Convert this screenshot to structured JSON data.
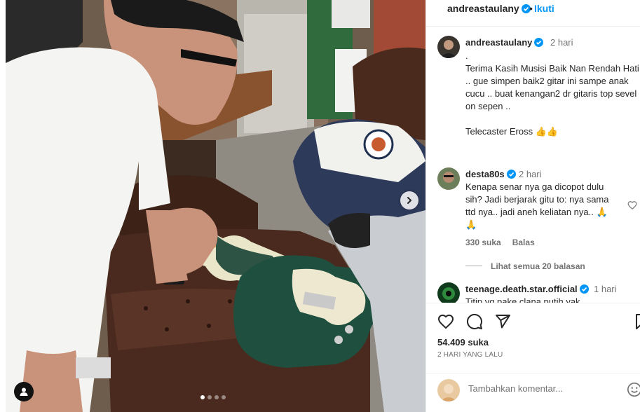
{
  "post": {
    "author": "andreastaulany",
    "separator": "•",
    "follow_label": "Ikuti",
    "more": "..."
  },
  "caption": {
    "username": "andreastaulany",
    "time": "2 hari",
    "text": ".\nTerima Kasih Musisi Baik Nan Rendah Hati .. gue simpen baik2 gitar ini sampe anak cucu .. buat kenangan2 dr gitaris top sevel on sepen ..\n\nTelecaster Eross 👍👍"
  },
  "comments": [
    {
      "username": "desta80s",
      "time": "2 hari",
      "text": "Kenapa senar nya ga dicopot dulu sih? Jadi berjarak gitu to: nya sama ttd nya.. jadi aneh keliatan nya.. 🙏 🙏",
      "likes": "330 suka",
      "reply_label": "Balas",
      "view_replies": "Lihat semua 20 balasan"
    },
    {
      "username": "teenage.death.star.official",
      "time": "1 hari",
      "text": "Titip yg pake clana putih yak"
    }
  ],
  "stats": {
    "likes": "54.409 suka",
    "date": "2 HARI YANG LALU"
  },
  "add_comment": {
    "placeholder": "Tambahkan komentar..."
  },
  "carousel": {
    "slides": 4,
    "active": 0
  },
  "icons": [
    "verified-icon",
    "heart-icon",
    "comment-icon",
    "share-icon",
    "bookmark-icon",
    "emoji-icon",
    "chevron-right-icon",
    "user-tag-icon"
  ],
  "colors": {
    "link": "#0095f6",
    "verified": "#0095f6",
    "text": "#262626",
    "muted": "#737373",
    "guitar_green": "#1f4f3f"
  }
}
